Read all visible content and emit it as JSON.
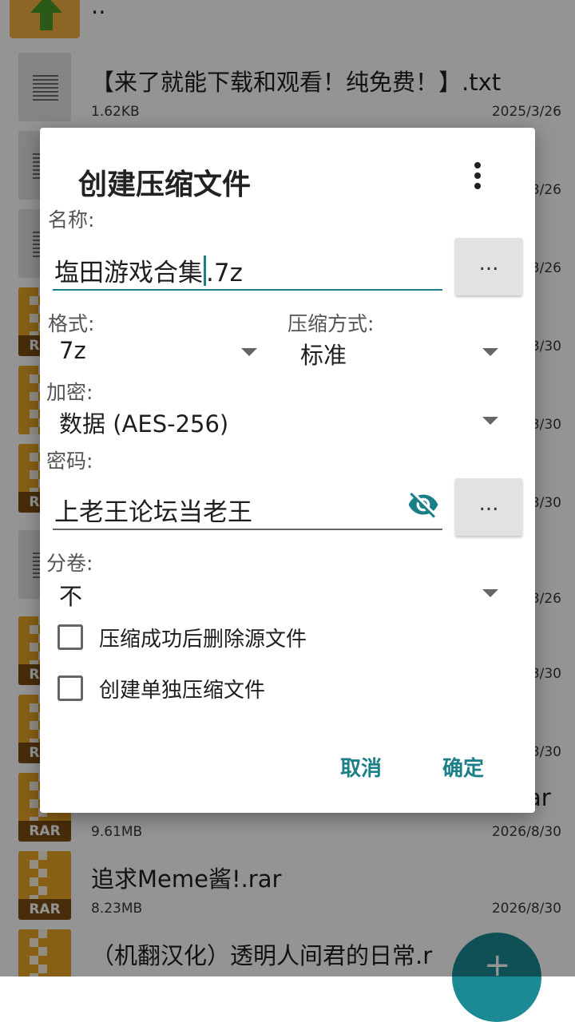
{
  "background": {
    "up_label": "..",
    "files": [
      {
        "name": "【来了就能下载和观看！纯免费！】.txt",
        "size": "1.62KB",
        "date": "2025/3/26",
        "type": "txt"
      },
      {
        "name": "",
        "size": "",
        "date": "3/26",
        "type": "txt"
      },
      {
        "name": "",
        "size": "",
        "date": "3/26",
        "type": "txt"
      },
      {
        "name": "",
        "size": "",
        "date": "3/30",
        "type": "rar"
      },
      {
        "name": "",
        "size": "",
        "date": "3/30",
        "type": "7z"
      },
      {
        "name": "",
        "size": "",
        "date": "3/30",
        "type": "rar"
      },
      {
        "name": "",
        "size": "",
        "date": "3/26",
        "type": "txt"
      },
      {
        "name": "",
        "size": "",
        "date": "3/30",
        "type": "rar"
      },
      {
        "name": "",
        "size": "",
        "date": "3/30",
        "type": "rar"
      },
      {
        "name": "ar",
        "size": "9.61MB",
        "date": "2026/8/30",
        "type": "rar"
      },
      {
        "name": "追求Meme酱!.rar",
        "size": "8.23MB",
        "date": "2026/8/30",
        "type": "rar"
      },
      {
        "name": "（机翻汉化）透明人间君的日常.r",
        "size": "",
        "date": "",
        "type": "rar"
      }
    ],
    "archive_badge": "RAR",
    "fab_icon": "plus-icon"
  },
  "dialog": {
    "title": "创建压缩文件",
    "menu_icon": "more-vert-icon",
    "name_label": "名称:",
    "name_before_cursor": "塩田游戏合集",
    "name_after_cursor": ".7z",
    "browse_label": "...",
    "format_label": "格式:",
    "format_value": "7z",
    "method_label": "压缩方式:",
    "method_value": "标准",
    "encrypt_label": "加密:",
    "encrypt_value": "数据 (AES-256)",
    "password_label": "密码:",
    "password_value": "上老王论坛当老王",
    "password_browse_label": "...",
    "eye_icon": "visibility-off-icon",
    "split_label": "分卷:",
    "split_value": "不",
    "delete_source_label": "压缩成功后删除源文件",
    "delete_source_checked": false,
    "separate_label": "创建单独压缩文件",
    "separate_checked": false,
    "cancel_label": "取消",
    "ok_label": "确定",
    "accent_color": "#1b7f88"
  }
}
